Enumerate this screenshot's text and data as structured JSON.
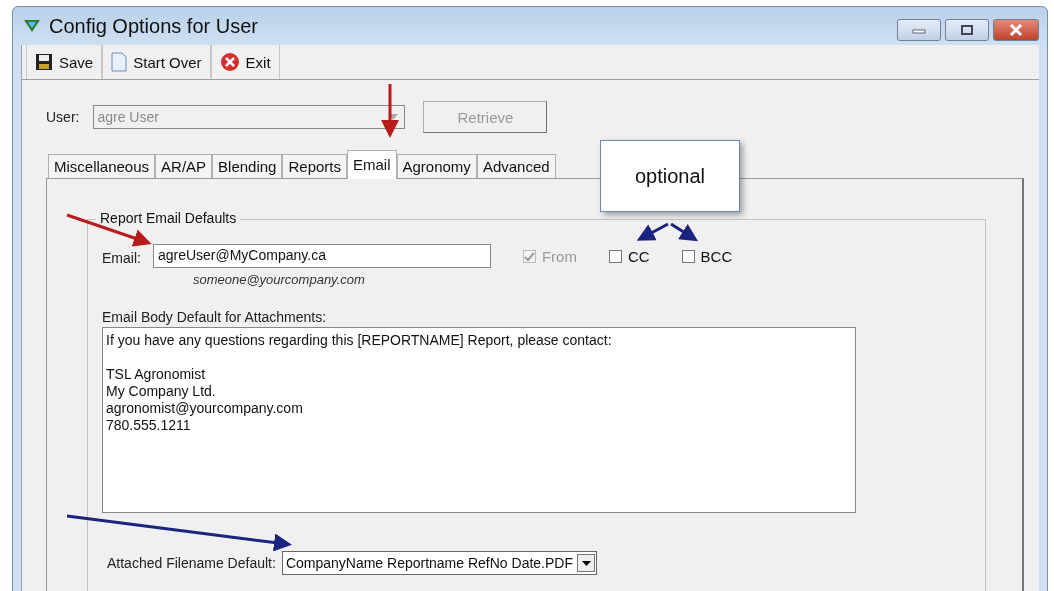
{
  "window": {
    "title": "Config Options for User"
  },
  "toolbar": [
    {
      "kind": "save",
      "label": "Save"
    },
    {
      "kind": "new",
      "label": "Start Over"
    },
    {
      "kind": "exit",
      "label": "Exit"
    }
  ],
  "user": {
    "label": "User:",
    "value": "agre User",
    "disabled": true,
    "retrieve": "Retrieve"
  },
  "tabs": [
    {
      "label": "Miscellaneous",
      "selected": false
    },
    {
      "label": "AR/AP",
      "selected": false
    },
    {
      "label": "Blending",
      "selected": false
    },
    {
      "label": "Reports",
      "selected": false
    },
    {
      "label": "Email",
      "selected": true
    },
    {
      "label": "Agronomy",
      "selected": false
    },
    {
      "label": "Advanced",
      "selected": false
    }
  ],
  "group": {
    "title": "Report Email Defaults",
    "email": {
      "label": "Email:",
      "value": "agreUser@MyCompany.ca",
      "hint": "someone@yourcompany.com"
    },
    "checkboxes": [
      {
        "label": "From",
        "checked": true,
        "disabled": true
      },
      {
        "label": "CC",
        "checked": false,
        "disabled": false
      },
      {
        "label": "BCC",
        "checked": false,
        "disabled": false
      }
    ],
    "body": {
      "label": "Email Body Default for Attachments:",
      "value": "If you have any questions regarding this [REPORTNAME] Report, please contact:\n\nTSL Agronomist\nMy Company Ltd.\nagronomist@yourcompany.com\n780.555.1211"
    },
    "filename": {
      "label": "Attached Filename Default:",
      "value": "CompanyName Reportname RefNo Date.PDF"
    }
  },
  "callout": {
    "text": "optional"
  }
}
